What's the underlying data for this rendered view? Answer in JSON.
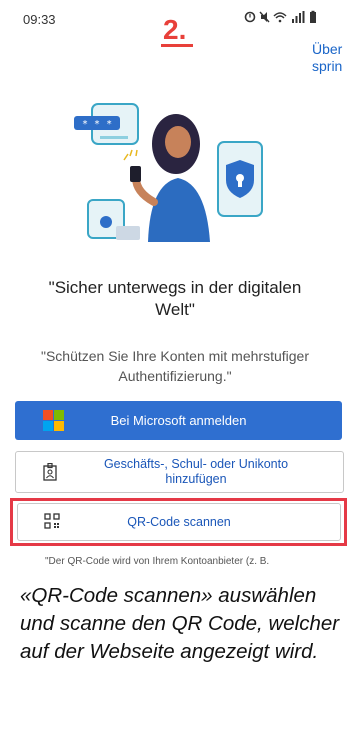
{
  "status_bar": {
    "time": "09:33",
    "icons": "alarm-icon mute-icon wifi-icon signal-icon battery-icon",
    "icons_display": "⏰ 🔇 ᯤ ▂▄▆ ▮"
  },
  "step_marker": "2.",
  "header": {
    "about_link": "Über sprin"
  },
  "illustration": {
    "desc_icon": "person-with-phone-and-security-screens-illustration"
  },
  "headline": "\"Sicher unterwegs in der digitalen Welt\"",
  "subtext": "\"Schützen Sie Ihre Konten mit mehrstufiger Authentifizierung.\"",
  "buttons": {
    "microsoft_signin": "Bei Microsoft anmelden",
    "add_work_account": "Geschäfts-, Schul- oder Unikonto hinzufügen",
    "scan_qr": "QR-Code scannen"
  },
  "footnote": "\"Der QR-Code wird von Ihrem Kontoanbieter (z. B.",
  "instruction": "«QR-Code scannen» auswählen und scanne den QR Code, welcher auf der Webseite angezeigt wird.",
  "colors": {
    "accent_blue": "#2f6fd0",
    "link_blue": "#1a56b8",
    "highlight_red": "#e53946",
    "step_red": "#e8403a"
  }
}
